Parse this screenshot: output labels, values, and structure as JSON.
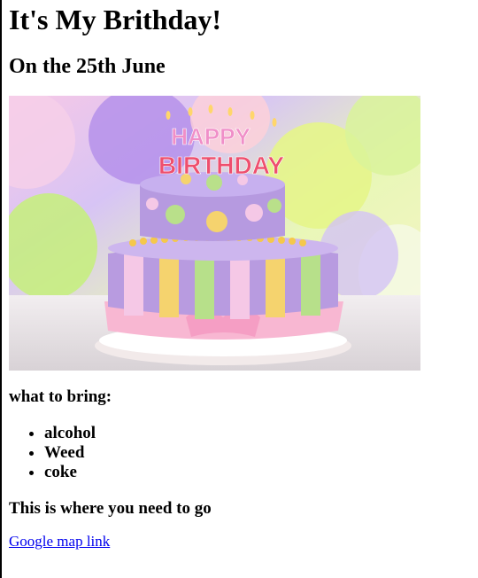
{
  "header": {
    "title": "It's My Brithday!",
    "subtitle": "On the 25th June"
  },
  "image": {
    "candle_text_top": "HAPPY",
    "candle_text_bottom": "BIRTHDAY"
  },
  "bring": {
    "label": "what to bring:",
    "items": [
      "alcohol",
      "Weed",
      "coke"
    ]
  },
  "location": {
    "label": "This is where you need to go",
    "link_text": "Google map link"
  },
  "colors": {
    "link": "#0000ee"
  }
}
